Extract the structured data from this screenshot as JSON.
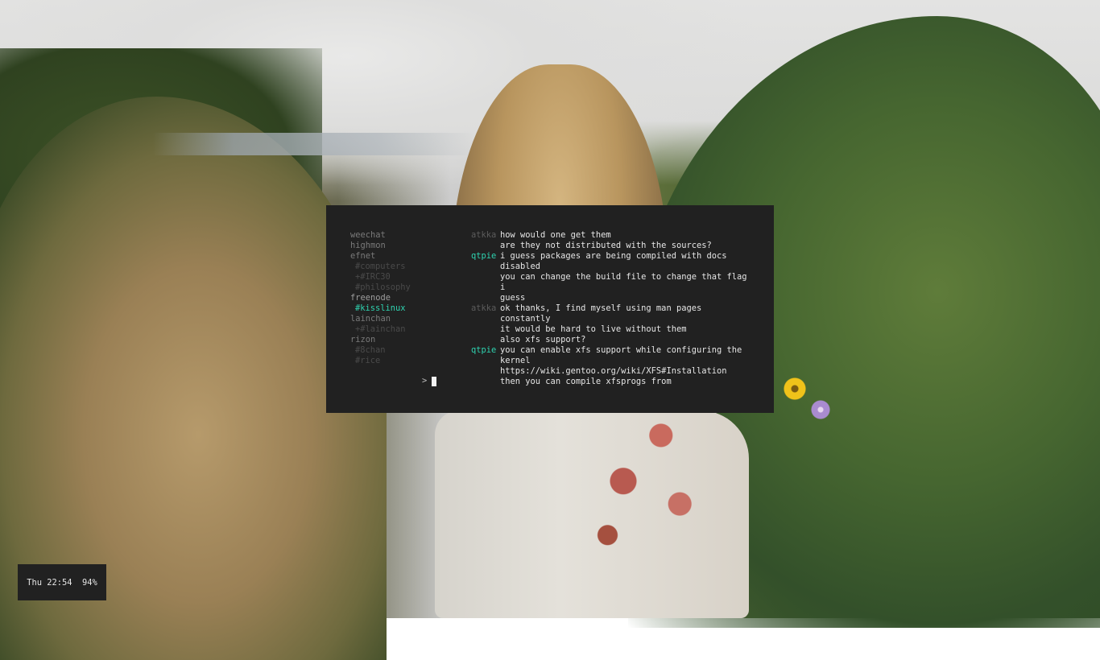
{
  "desktop": {
    "wallpaper": "photo-woman-flowers-valley"
  },
  "terminal": {
    "sidebar": [
      {
        "label": "weechat",
        "type": "server",
        "active": false
      },
      {
        "label": "highmon",
        "type": "server",
        "active": false
      },
      {
        "label": "efnet",
        "type": "server",
        "active": false
      },
      {
        "label": "#computers",
        "type": "channel",
        "active": false
      },
      {
        "label": "+#IRC30",
        "type": "channel",
        "active": false
      },
      {
        "label": "#philosophy",
        "type": "channel",
        "active": false
      },
      {
        "label": "freenode",
        "type": "server",
        "active": true
      },
      {
        "label": "#kisslinux",
        "type": "channel",
        "active": true
      },
      {
        "label": "lainchan",
        "type": "server",
        "active": false
      },
      {
        "label": "+#lainchan",
        "type": "channel",
        "active": false
      },
      {
        "label": "rizon",
        "type": "server",
        "active": false
      },
      {
        "label": "#8chan",
        "type": "channel",
        "active": false
      },
      {
        "label": "#rice",
        "type": "channel",
        "active": false
      }
    ],
    "messages": [
      {
        "nick": "atkka",
        "text": "how would one get them"
      },
      {
        "nick": "",
        "text": "are they not distributed with the sources?"
      },
      {
        "nick": "qtpie",
        "text": "i guess packages are being compiled with docs\ndisabled"
      },
      {
        "nick": "",
        "text": "you can change the build file to change that flag i\nguess"
      },
      {
        "nick": "atkka",
        "text": "ok thanks, I find myself using man pages constantly"
      },
      {
        "nick": "",
        "text": "it would be hard to live without them"
      },
      {
        "nick": "",
        "text": "also xfs support?"
      },
      {
        "nick": "qtpie",
        "text": "you can enable xfs support while configuring the\nkernel"
      },
      {
        "nick": "",
        "text": "https://wiki.gentoo.org/wiki/XFS#Installation"
      },
      {
        "nick": "",
        "text": "then you can compile xfsprogs from"
      }
    ],
    "prompt": ">",
    "colors": {
      "background": "#212121",
      "accent": "#2fd3b0"
    }
  },
  "statusbar": {
    "text": "Thu 22:54  94%"
  }
}
